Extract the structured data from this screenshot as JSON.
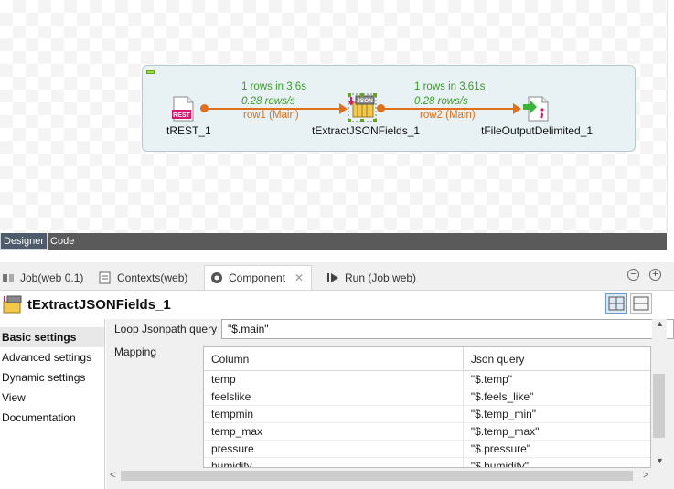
{
  "designer": {
    "components": [
      {
        "name": "tREST_1",
        "icon": "rest-icon",
        "badge": "REST"
      },
      {
        "name": "tExtractJSONFields_1",
        "icon": "json-icon",
        "badge": "JSON"
      },
      {
        "name": "tFileOutputDelimited_1",
        "icon": "file-output-icon"
      }
    ],
    "flows": [
      {
        "count": "1 rows in 3.6s",
        "rate": "0.28 rows/s",
        "name": "row1 (Main)"
      },
      {
        "count": "1 rows in 3.61s",
        "rate": "0.28 rows/s",
        "name": "row2 (Main)"
      }
    ],
    "tabs": [
      "Designer",
      "Code"
    ]
  },
  "views": {
    "tabs": [
      {
        "label": "Job(web 0.1)",
        "icon": "job-icon"
      },
      {
        "label": "Contexts(web)",
        "icon": "contexts-icon"
      },
      {
        "label": "Component",
        "icon": "component-icon"
      },
      {
        "label": "Run (Job web)",
        "icon": "run-icon"
      }
    ],
    "active_tab": "Component",
    "close_label": "✕",
    "minimize_label": "−",
    "maximize_label": "+"
  },
  "component": {
    "title": "tExtractJSONFields_1",
    "nav": [
      "Basic settings",
      "Advanced settings",
      "Dynamic settings",
      "View",
      "Documentation"
    ],
    "loop_label": "Loop Jsonpath query",
    "loop_value": "\"$.main\"",
    "mapping_label": "Mapping",
    "mapping": {
      "headers": [
        "Column",
        "Json query"
      ],
      "rows": [
        {
          "column": "temp",
          "query": "\"$.temp\""
        },
        {
          "column": "feelslike",
          "query": "\"$.feels_like\""
        },
        {
          "column": "tempmin",
          "query": "\"$.temp_min\""
        },
        {
          "column": "temp_max",
          "query": "\"$.temp_max\""
        },
        {
          "column": "pressure",
          "query": "\"$.pressure\""
        },
        {
          "column": "humidity",
          "query": "\"$.humidity\""
        }
      ]
    }
  },
  "colors": {
    "link": "#e0701a",
    "flow_stat": "#3a9a28",
    "subjob_bg": "#e8f2f5"
  }
}
